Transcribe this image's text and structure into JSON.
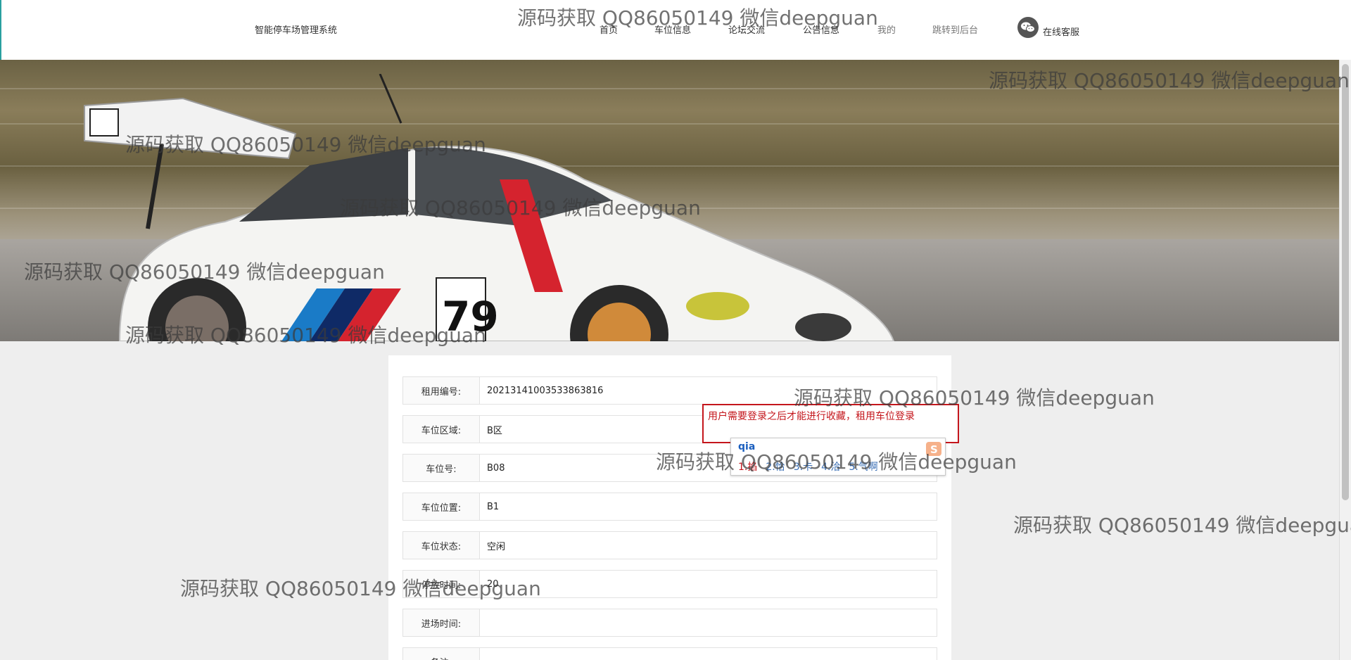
{
  "header": {
    "brand": "智能停车场管理系统",
    "nav": [
      {
        "label": "首页"
      },
      {
        "label": "车位信息"
      },
      {
        "label": "论坛交流"
      },
      {
        "label": "公告信息"
      },
      {
        "label": "我的"
      },
      {
        "label": "跳转到后台"
      }
    ],
    "service_label": "在线客服",
    "service_icon": "wechat-icon"
  },
  "form": {
    "fields": [
      {
        "label": "租用编号:",
        "value": "20213141003533863816"
      },
      {
        "label": "车位区域:",
        "value": "B区"
      },
      {
        "label": "车位号:",
        "value": "B08"
      },
      {
        "label": "车位位置:",
        "value": "B1"
      },
      {
        "label": "车位状态:",
        "value": "空闲"
      },
      {
        "label": "停放时间:",
        "value": "20"
      },
      {
        "label": "进场时间:",
        "value": ""
      },
      {
        "label": "备注:",
        "value": ""
      }
    ]
  },
  "tooltip": {
    "text": "用户需要登录之后才能进行收藏，租用车位登录"
  },
  "ime": {
    "composition": "qia",
    "candidates": [
      "1.掐",
      "2.恰",
      "3.卡",
      "4.洽",
      "5.气啊"
    ]
  },
  "watermark": {
    "text": "源码获取 QQ86050149 微信deepguan"
  },
  "colors": {
    "alert": "#c4161c",
    "header_bg": "#ffffff",
    "page_bg": "#eeeeee"
  }
}
